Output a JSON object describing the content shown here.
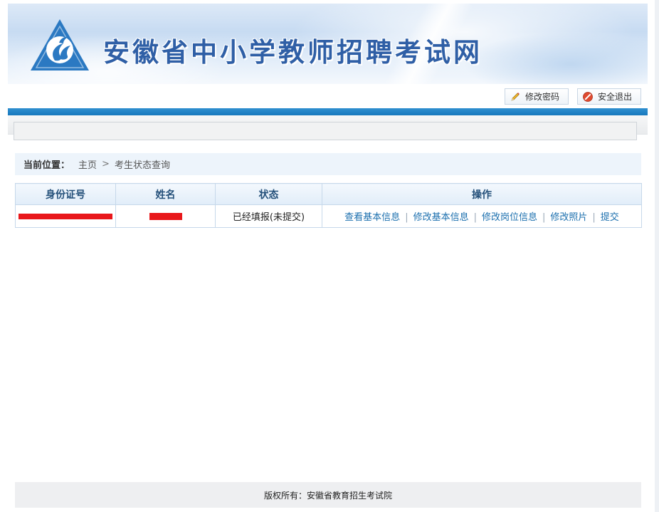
{
  "site": {
    "title": "安徽省中小学教师招聘考试网"
  },
  "toolbar": {
    "change_password_label": "修改密码",
    "logout_label": "安全退出",
    "change_password_icon": "pencil-icon",
    "logout_icon": "no-entry-icon"
  },
  "breadcrumb": {
    "label": "当前位置：",
    "home": "主页",
    "separator": ">",
    "current": "考生状态查询"
  },
  "table": {
    "headers": [
      "身份证号",
      "姓名",
      "状态",
      "操作"
    ],
    "rows": [
      {
        "status": "已经填报(未提交)",
        "actions": [
          "查看基本信息",
          "修改基本信息",
          "修改岗位信息",
          "修改照片",
          "提交"
        ]
      }
    ],
    "action_separator": "|"
  },
  "footer": {
    "copyright": "版权所有：安徽省教育招生考试院"
  },
  "colors": {
    "brand_blue": "#1778bd",
    "link_blue": "#1b6fae",
    "redaction_red": "#e8171b"
  }
}
